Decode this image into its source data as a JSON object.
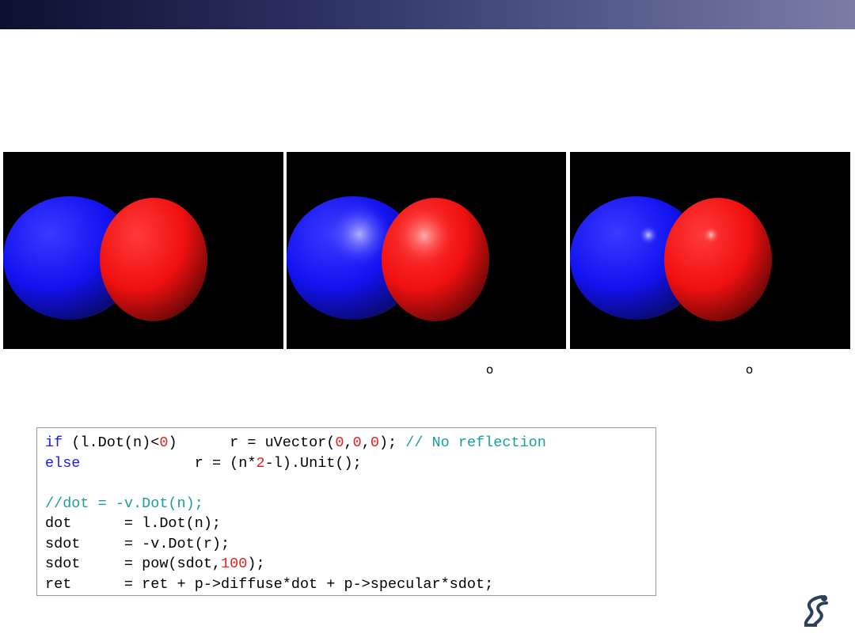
{
  "renders": [
    {
      "name": "diffuse-only",
      "highlight": false
    },
    {
      "name": "specular-broad",
      "highlight": "broad"
    },
    {
      "name": "specular-sharp",
      "highlight": "sharp"
    }
  ],
  "captions": {
    "degree_mark_1": "o",
    "degree_mark_2": "o"
  },
  "code": {
    "line1": {
      "kw": "if",
      "a": " (l.Dot(n)<",
      "n0": "0",
      "b": ")      r = uVector(",
      "n1": "0",
      "c": ",",
      "n2": "0",
      "d": ",",
      "n3": "0",
      "e": "); ",
      "cm": "// No reflection"
    },
    "line2": {
      "kw": "else",
      "a": "             r = (n*",
      "n4": "2",
      "b": "-l).Unit();"
    },
    "line3": {
      "cm": "//dot = -v.Dot(n);"
    },
    "line4": "dot      = l.Dot(n);",
    "line5": "sdot     = -v.Dot(r);",
    "line6": {
      "a": "sdot     = pow(sdot,",
      "n": "100",
      "b": ");"
    },
    "line7": "ret      = ret + p->diffuse*dot + p->specular*sdot;"
  },
  "colors": {
    "blue_sphere": "#1010ff",
    "red_sphere": "#ff1414",
    "keyword": "#1a1ae6",
    "number": "#e8231a",
    "comment": "#1a9e9e"
  },
  "icons": {
    "logo": "robot-arm-logo"
  }
}
